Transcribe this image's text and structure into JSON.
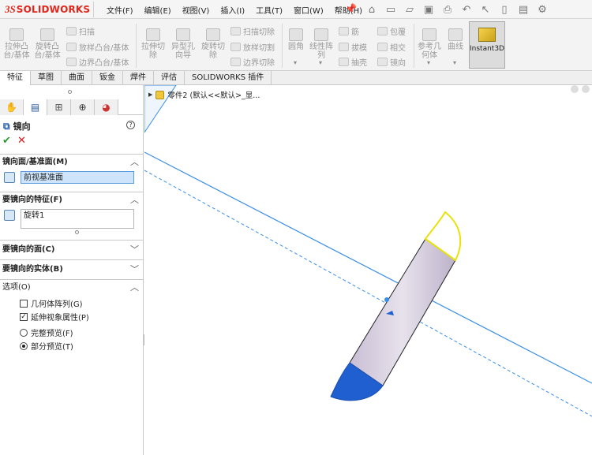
{
  "app": {
    "logo_ds": "3S",
    "logo_text": "SOLIDWORKS"
  },
  "menu": [
    "文件(F)",
    "编辑(E)",
    "视图(V)",
    "插入(I)",
    "工具(T)",
    "窗口(W)",
    "帮助(H)"
  ],
  "ribbon": {
    "extrude_boss": "拉伸凸\n台/基体",
    "revolve_boss": "旋转凸\n台/基体",
    "sweep": "扫描",
    "loft_boss": "放样凸台/基体",
    "boundary_boss": "边界凸台/基体",
    "extrude_cut": "拉伸切\n除",
    "hole_wizard": "异型孔\n向导",
    "revolve_cut": "旋转切\n除",
    "sweep_cut": "扫描切除",
    "loft_cut": "放样切割",
    "boundary_cut": "边界切除",
    "fillet": "圆角",
    "linear_pattern": "线性阵\n列",
    "rib": "筋",
    "draft": "拔模",
    "shell": "抽壳",
    "wrap": "包覆",
    "intersect": "相交",
    "mirror": "镜向",
    "ref_geometry": "参考几\n何体",
    "curves": "曲线",
    "instant3d": "Instant3D"
  },
  "tabs": [
    "特征",
    "草图",
    "曲面",
    "钣金",
    "焊件",
    "评估",
    "SOLIDWORKS 插件"
  ],
  "active_tab": 0,
  "panel": {
    "feature_title": "镜向",
    "help_label": "?",
    "ok_label": "✔",
    "cancel_label": "✕",
    "sections": {
      "mirror_plane": {
        "title": "镜向面/基准面(M)",
        "value": "前视基准面"
      },
      "features": {
        "title": "要镜向的特征(F)",
        "items": [
          "旋转1"
        ]
      },
      "faces": {
        "title": "要镜向的面(C)"
      },
      "bodies": {
        "title": "要镜向的实体(B)"
      },
      "options": {
        "title": "选项(O)",
        "geometry_pattern": {
          "label": "几何体阵列(G)",
          "checked": false
        },
        "propagate_visual": {
          "label": "延伸视象属性(P)",
          "checked": true
        },
        "full_preview": {
          "label": "完整预览(F)",
          "selected": false
        },
        "partial_preview": {
          "label": "部分预览(T)",
          "selected": true
        }
      }
    }
  },
  "tree": {
    "part_label": "零件2  (默认<<默认>_显..."
  },
  "colors": {
    "accent_blue": "#3a8ee6",
    "body_blue": "#1f5fcf",
    "selection_yellow": "#e8e20a",
    "logo_red": "#e1251b"
  }
}
